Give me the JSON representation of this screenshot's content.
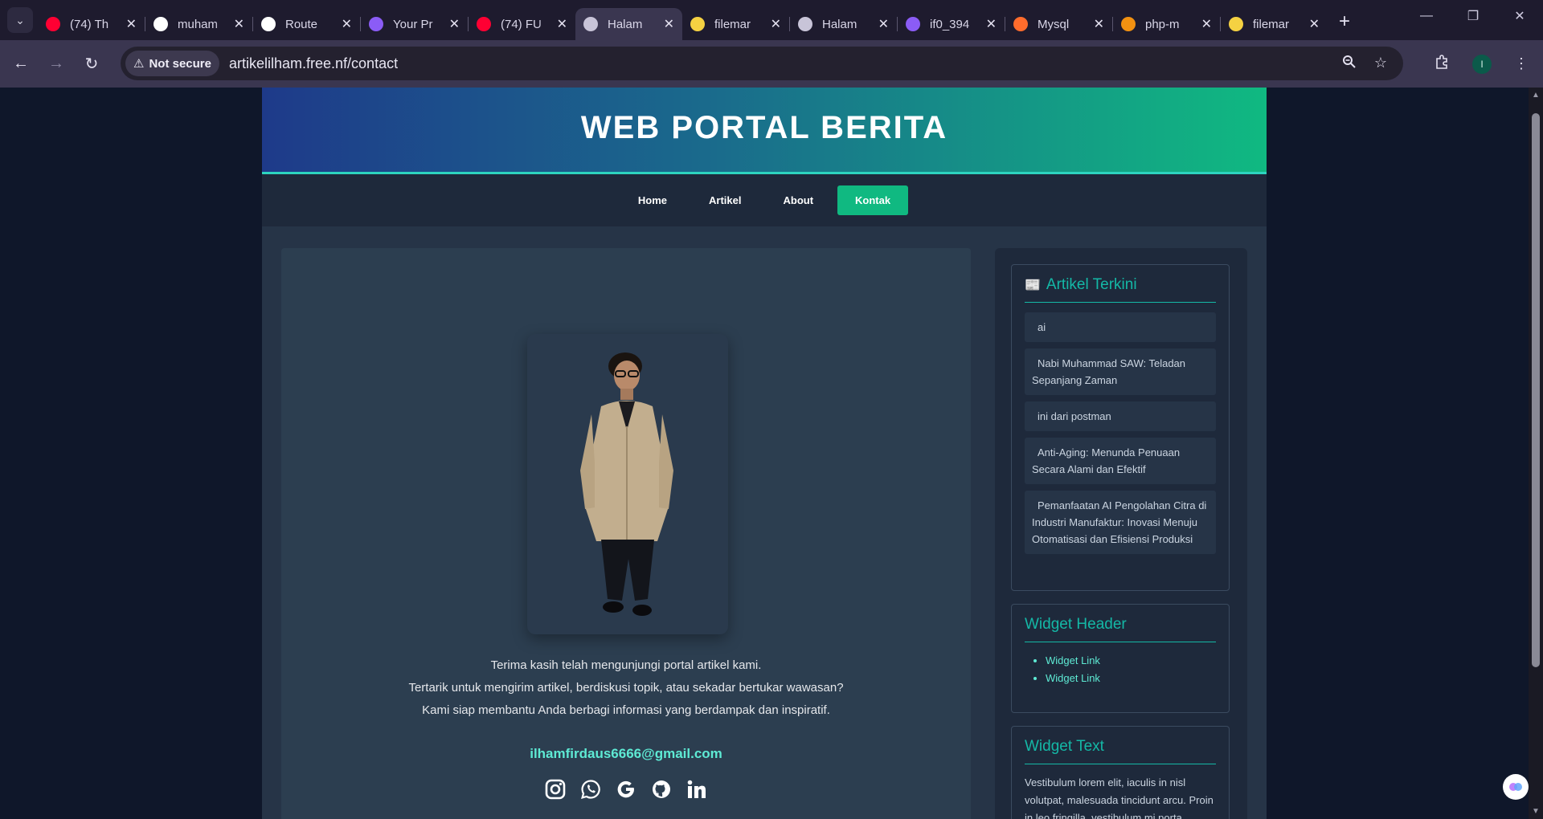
{
  "browser": {
    "tabs": [
      {
        "title": "(74) Th",
        "favicon": "youtube-icon",
        "color": "#ff0033",
        "active": false
      },
      {
        "title": "muham",
        "favicon": "github-icon",
        "color": "#ffffff",
        "active": false
      },
      {
        "title": "Route",
        "favicon": "openai-icon",
        "color": "#ffffff",
        "active": false
      },
      {
        "title": "Your Pr",
        "favicon": "infinity-icon",
        "color": "#8b5cf6",
        "active": false
      },
      {
        "title": "(74) FU",
        "favicon": "youtube-icon",
        "color": "#ff0033",
        "active": false
      },
      {
        "title": "Halam",
        "favicon": "globe-icon",
        "color": "#c8c4d8",
        "active": true
      },
      {
        "title": "filemar",
        "favicon": "filemanager-icon",
        "color": "#f5d142",
        "active": false
      },
      {
        "title": "Halam",
        "favicon": "globe-icon",
        "color": "#c8c4d8",
        "active": false
      },
      {
        "title": "if0_394",
        "favicon": "infinity-icon",
        "color": "#8b5cf6",
        "active": false
      },
      {
        "title": "Mysql",
        "favicon": "cpanel-icon",
        "color": "#ff6c2c",
        "active": false
      },
      {
        "title": "php-m",
        "favicon": "phpmyadmin-icon",
        "color": "#f29111",
        "active": false
      },
      {
        "title": "filemar",
        "favicon": "filemanager-icon",
        "color": "#f5d142",
        "active": false
      }
    ],
    "security_label": "Not secure",
    "url": "artikelilham.free.nf/contact",
    "profile_initial": "I"
  },
  "site": {
    "title": "WEB PORTAL BERITA",
    "nav": [
      {
        "label": "Home",
        "active": false
      },
      {
        "label": "Artikel",
        "active": false
      },
      {
        "label": "About",
        "active": false
      },
      {
        "label": "Kontak",
        "active": true
      }
    ],
    "contact": {
      "message_lines": [
        "Terima kasih telah mengunjungi portal artikel kami.",
        "Tertarik untuk mengirim artikel, berdiskusi topik, atau sekadar bertukar wawasan?",
        "Kami siap membantu Anda berbagi informasi yang berdampak dan inspiratif."
      ],
      "email": "ilhamfirdaus6666@gmail.com",
      "socials": [
        "instagram-icon",
        "whatsapp-icon",
        "google-icon",
        "github-icon",
        "linkedin-icon"
      ]
    },
    "sidebar": {
      "recent_title": "Artikel Terkini",
      "recent_articles": [
        "ai",
        "Nabi Muhammad SAW: Teladan Sepanjang Zaman",
        "ini dari postman",
        "Anti-Aging: Menunda Penuaan Secara Alami dan Efektif",
        "Pemanfaatan AI Pengolahan Citra di Industri Manufaktur: Inovasi Menuju Otomatisasi dan Efisiensi Produksi"
      ],
      "widget_header_title": "Widget Header",
      "widget_links": [
        "Widget Link",
        "Widget Link"
      ],
      "widget_text_title": "Widget Text",
      "widget_text": "Vestibulum lorem elit, iaculis in nisl volutpat, malesuada tincidunt arcu. Proin in leo fringilla, vestibulum mi porta, faucibus felis."
    }
  }
}
